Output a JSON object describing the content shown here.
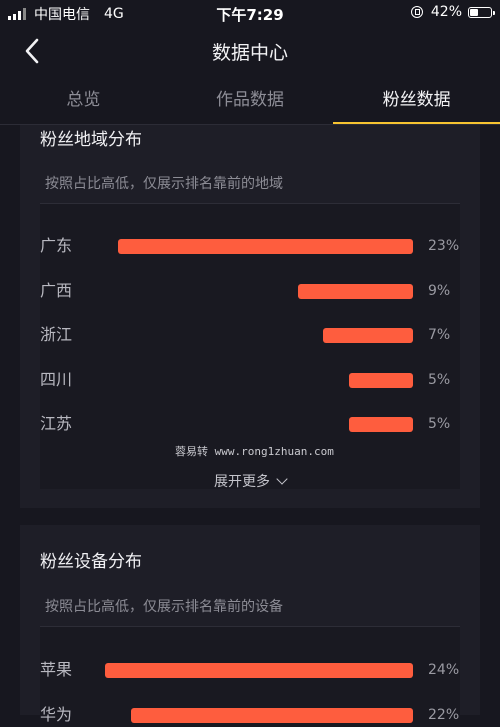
{
  "status_bar": {
    "carrier": "中国电信",
    "network": "4G",
    "time": "下午7:29",
    "battery": "42%",
    "battery_level": 0.42
  },
  "header": {
    "title": "数据中心",
    "back_icon": "chevron-left-icon"
  },
  "tabs": [
    {
      "label": "总览",
      "active": false
    },
    {
      "label": "作品数据",
      "active": false
    },
    {
      "label": "粉丝数据",
      "active": true
    }
  ],
  "region_card": {
    "title": "粉丝地域分布",
    "subtitle": "按照占比高低，仅展示排名靠前的地域",
    "watermark": "蓉易转 www.rong1zhuan.com",
    "more_label": "展开更多"
  },
  "device_card": {
    "title": "粉丝设备分布",
    "subtitle": "按照占比高低，仅展示排名靠前的设备"
  },
  "chart_data": [
    {
      "type": "bar",
      "orientation": "horizontal",
      "categories": [
        "广东",
        "广西",
        "浙江",
        "四川",
        "江苏"
      ],
      "values": [
        23,
        9,
        7,
        5,
        5
      ],
      "labels": [
        "23%",
        "9%",
        "7%",
        "5%",
        "5%"
      ],
      "unit": "%",
      "bar_color": "#fe5d3e"
    },
    {
      "type": "bar",
      "orientation": "horizontal",
      "categories": [
        "苹果",
        "华为"
      ],
      "values": [
        24,
        22
      ],
      "labels": [
        "24%",
        "22%"
      ],
      "unit": "%",
      "bar_color": "#fe5d3e"
    }
  ],
  "colors": {
    "background": "#17171f",
    "card": "#1e1e27",
    "accent": "#f7c431",
    "bar": "#fe5d3e"
  }
}
